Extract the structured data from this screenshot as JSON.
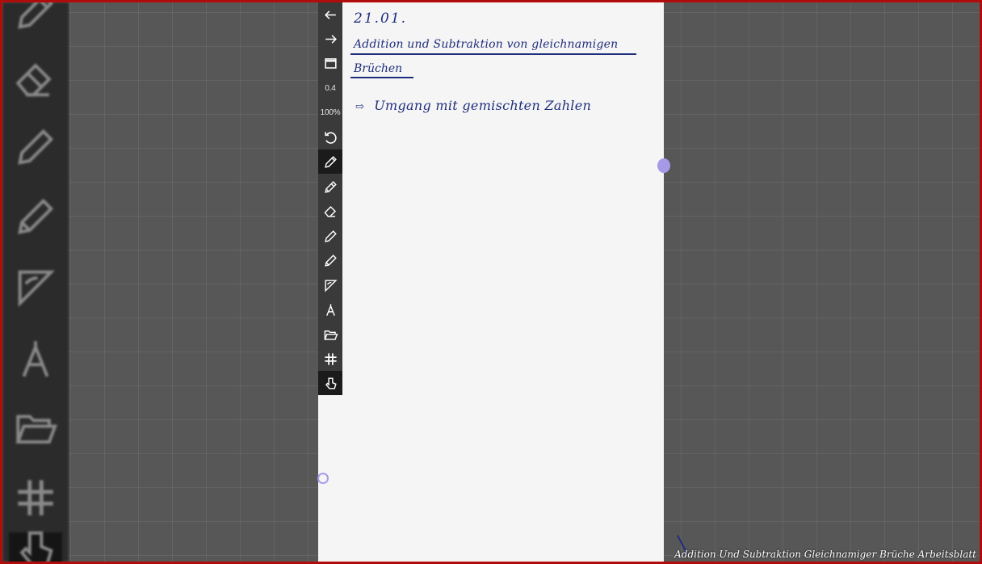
{
  "toolbar": {
    "stroke_width": "0.4",
    "zoom": "100%",
    "items": [
      {
        "icon": "arrow-left-icon"
      },
      {
        "icon": "arrow-right-icon"
      },
      {
        "icon": "window-icon"
      },
      {
        "icon": "undo-icon"
      },
      {
        "icon": "pen-icon",
        "selected": true
      },
      {
        "icon": "pencil-icon"
      },
      {
        "icon": "eraser-icon"
      },
      {
        "icon": "marker-icon"
      },
      {
        "icon": "highlighter-icon"
      },
      {
        "icon": "set-square-icon"
      },
      {
        "icon": "compass-icon"
      },
      {
        "icon": "folder-open-icon"
      },
      {
        "icon": "grid-icon"
      },
      {
        "icon": "hand-pointer-icon",
        "selected": true
      }
    ]
  },
  "note": {
    "date": "21.01.",
    "title_line1": "Addition und Subtraktion von gleichnamigen",
    "title_line2": "Brüchen",
    "bullet_arrow": "⇨",
    "bullet_text": "Umgang mit gemischten Zahlen"
  },
  "colors": {
    "ink": "#1f2e7c",
    "border": "#b10c0c",
    "handle": "#a69ae8",
    "page": "#f5f5f5",
    "toolbar": "#3a3a3a"
  },
  "watermark": "Addition Und Subtraktion Gleichnamiger Brüche Arbeitsblatt"
}
